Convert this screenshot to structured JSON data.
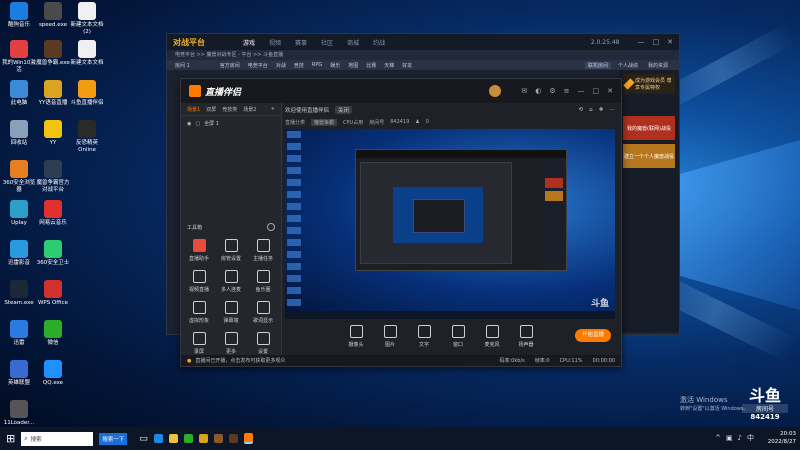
{
  "desktop": {
    "icons": [
      {
        "label": "酷狗音乐",
        "color": "#1a7de0"
      },
      {
        "label": "speed.exe",
        "color": "#4a4a4a"
      },
      {
        "label": "新建文本文档 (2)",
        "color": "#f0f0f0"
      },
      {
        "label": "我的Win10激活",
        "color": "#e04040"
      },
      {
        "label": "魔兽争霸.exe",
        "color": "#5a3a20"
      },
      {
        "label": "新建文本文档",
        "color": "#f0f0f0"
      },
      {
        "label": "此电脑",
        "color": "#3a8ad8"
      },
      {
        "label": "YY语音直播",
        "color": "#d9a520"
      },
      {
        "label": "斗鱼直播伴侣",
        "color": "#f39c12"
      },
      {
        "label": "回收站",
        "color": "#8aa0b8"
      },
      {
        "label": "YY",
        "color": "#f1c40f"
      },
      {
        "label": "反恐精英 Online",
        "color": "#2a2a2a"
      },
      {
        "label": "360安全浏览器",
        "color": "#e67e22"
      },
      {
        "label": "魔兽争霸官方对战平台",
        "color": "#2c3e50"
      },
      {
        "label": "Uplay",
        "color": "#2aa0c8"
      },
      {
        "label": "网易云音乐",
        "color": "#e03030"
      },
      {
        "label": "迅雷影音",
        "color": "#2a9ae0"
      },
      {
        "label": "360安全卫士",
        "color": "#2ecc71"
      },
      {
        "label": "Steam.exe",
        "color": "#1b2838"
      },
      {
        "label": "WPS Office",
        "color": "#d0312d"
      },
      {
        "label": "迅雷",
        "color": "#2a7ae0"
      },
      {
        "label": "微信",
        "color": "#2aae2a"
      },
      {
        "label": "英雄联盟",
        "color": "#3a6ad0"
      },
      {
        "label": "QQ.exe",
        "color": "#1e90ff"
      },
      {
        "label": "11Loader...",
        "color": "#555"
      }
    ]
  },
  "game_platform": {
    "logo_text": "对战平台",
    "nav": [
      "游戏",
      "视频",
      "赛事",
      "社区",
      "商城",
      "约战"
    ],
    "version": "2.0.25.48",
    "breadcrumb": "电竞平台 >> 魔兽对战专区 - 平台 >> 斗鱼直播",
    "room_label": "房间 1",
    "room_tabs": [
      "官方房间",
      "电竞平台",
      "对战",
      "竞技",
      "RPG",
      "娱乐",
      "地图",
      "比赛",
      "天梯",
      "好友"
    ],
    "right_tabs": [
      "联机房间",
      "个人战绩",
      "我的资源"
    ],
    "promo": "成为游戏会员 尊享专属特权",
    "banner1": "我的魔兽(联网)战役",
    "banner2": "建立一个个人魔兽战役"
  },
  "livestream": {
    "title": "直播伴侣",
    "tabs": [
      "场景1",
      "双屏",
      "竞技类",
      "场景2"
    ],
    "scene_item": "全屏 1",
    "notice": "欢迎使用直播伴侣",
    "notice_action": "关闭",
    "category_label": "直播分类",
    "category_value": "魔兽争霸",
    "quality_label": "CPU占用",
    "room_id_label": "房间号",
    "room_id": "842419",
    "viewers": "0",
    "tools_header": "工具箱",
    "tools": [
      {
        "label": "直播助手",
        "color": "#e74c3c"
      },
      {
        "label": "房管设置",
        "color": "#cfcfcf"
      },
      {
        "label": "主播任务",
        "color": "#cfcfcf"
      },
      {
        "label": "视频直播",
        "color": "#cfcfcf"
      },
      {
        "label": "多人连麦",
        "color": "#cfcfcf"
      },
      {
        "label": "鱼乐圈",
        "color": "#cfcfcf"
      },
      {
        "label": "虚拟形象",
        "color": "#cfcfcf"
      },
      {
        "label": "弹幕墙",
        "color": "#cfcfcf"
      },
      {
        "label": "歌词显示",
        "color": "#cfcfcf"
      },
      {
        "label": "录屏",
        "color": "#cfcfcf"
      },
      {
        "label": "更多",
        "color": "#cfcfcf"
      },
      {
        "label": "设置",
        "color": "#cfcfcf"
      }
    ],
    "bottom_tools": [
      "摄像头",
      "图片",
      "文字",
      "窗口",
      "麦克风",
      "扬声器"
    ],
    "start_button": "开始直播",
    "status_tip": "直播间已开播，点击发布可获取更多观众",
    "stats": [
      "码率:0kb/s",
      "帧率:0",
      "CPU:11%",
      "00:00:00"
    ]
  },
  "watermark": {
    "brand": "斗鱼",
    "room_label": "房间号",
    "room_id": "842419"
  },
  "activation": {
    "line1": "激活 Windows",
    "line2": "转到\"设置\"以激活 Windows。"
  },
  "taskbar": {
    "search_placeholder": "搜索",
    "search_button": "搜索一下",
    "time": "20:03",
    "date": "2022/8/27"
  },
  "colors": {
    "accent_orange": "#f5a623",
    "douyu_orange": "#ff7a00",
    "platform_red": "#c0392b"
  }
}
